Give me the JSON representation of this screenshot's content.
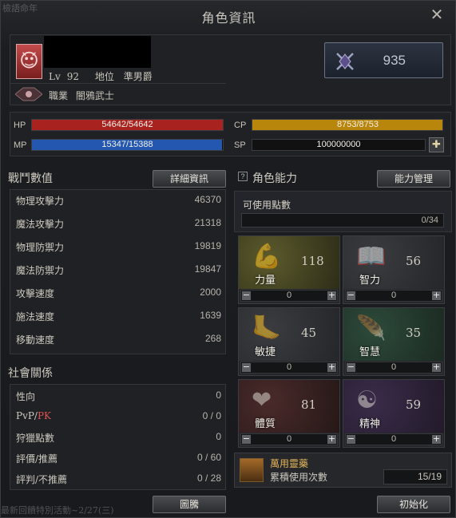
{
  "background_text_top": "檢語命年",
  "background_text_bottom": "最新回饋特別活動~2/27(三)",
  "window": {
    "title": "角色資訊",
    "close_icon": "close-icon"
  },
  "character": {
    "level_label": "Lv",
    "level": "92",
    "rank_label": "地位",
    "rank": "準男爵",
    "job_label": "職業",
    "job": "闇鴉武士",
    "faction_score": "935",
    "avatar_icon": "demon-crest-icon",
    "job_icon": "job-emblem-icon"
  },
  "bars": {
    "hp": {
      "label": "HP",
      "text": "54642/54642",
      "current": 54642,
      "max": 54642,
      "color": "#a8231f"
    },
    "mp": {
      "label": "MP",
      "text": "15347/15388",
      "current": 15347,
      "max": 15388,
      "color": "#2457b0"
    },
    "cp": {
      "label": "CP",
      "text": "8753/8753",
      "current": 8753,
      "max": 8753,
      "color": "#b8860b"
    },
    "sp": {
      "label": "SP",
      "text": "100000000"
    }
  },
  "combat": {
    "title": "戰鬥數值",
    "detail_button": "詳細資訊",
    "stats": [
      {
        "label": "物理攻擊力",
        "value": "46370"
      },
      {
        "label": "魔法攻擊力",
        "value": "21318"
      },
      {
        "label": "物理防禦力",
        "value": "19819"
      },
      {
        "label": "魔法防禦力",
        "value": "19847"
      },
      {
        "label": "攻擊速度",
        "value": "2000"
      },
      {
        "label": "施法速度",
        "value": "1639"
      },
      {
        "label": "移動速度",
        "value": "268"
      }
    ]
  },
  "social": {
    "title": "社會關係",
    "rows": [
      {
        "label": "性向",
        "value": "0"
      },
      {
        "label_a": "PvP/",
        "label_b": "PK",
        "value": "0 / 0"
      },
      {
        "label": "狩獵點數",
        "value": "0"
      },
      {
        "label": "評價/推薦",
        "value": "0 / 60"
      },
      {
        "label": "評判/不推薦",
        "value": "0 / 28"
      }
    ]
  },
  "abilities": {
    "title": "角色能力",
    "manage_button": "能力管理",
    "points_label": "可使用點數",
    "points_value": "0/34",
    "items": [
      {
        "name": "力量",
        "value": "118",
        "alloc": "0",
        "icon": "arm-icon"
      },
      {
        "name": "智力",
        "value": "56",
        "alloc": "0",
        "icon": "book-icon"
      },
      {
        "name": "敏捷",
        "value": "45",
        "alloc": "0",
        "icon": "foot-icon"
      },
      {
        "name": "智慧",
        "value": "35",
        "alloc": "0",
        "icon": "feather-icon"
      },
      {
        "name": "體質",
        "value": "81",
        "alloc": "0",
        "icon": "heart-icon"
      },
      {
        "name": "精神",
        "value": "59",
        "alloc": "0",
        "icon": "mind-icon"
      }
    ]
  },
  "elixir": {
    "name": "萬用靈藥",
    "usage_label": "累積使用次數",
    "usage": "15/19"
  },
  "footer": {
    "left_button": "圖騰",
    "right_button": "初始化"
  }
}
